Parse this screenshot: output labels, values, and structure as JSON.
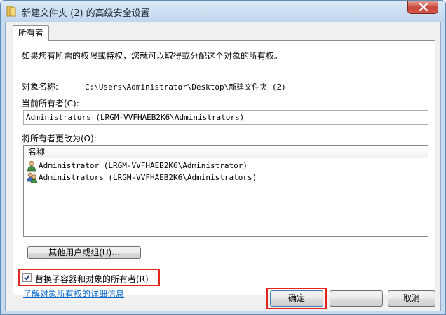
{
  "window": {
    "title": "新建文件夹 (2) 的高级安全设置",
    "close_label": "×"
  },
  "tab": {
    "label": "所有者"
  },
  "intro_text": "如果您有所需的权限或特权，您就可以取得或分配这个对象的所有权。",
  "object_name": {
    "label": "对象名称:",
    "value": "C:\\Users\\Administrator\\Desktop\\新建文件夹 (2)"
  },
  "current_owner": {
    "label": "当前所有者(C):",
    "value": "Administrators (LRGM-VVFHAEB2K6\\Administrators)"
  },
  "change_owner": {
    "label": "将所有者更改为(O):",
    "column_header": "名称",
    "items": [
      {
        "icon": "user-icon",
        "label": "Administrator (LRGM-VVFHAEB2K6\\Administrator)"
      },
      {
        "icon": "group-icon",
        "label": "Administrators (LRGM-VVFHAEB2K6\\Administrators)"
      }
    ]
  },
  "other_users_button": "其他用户或组(U)...",
  "replace_owner_checkbox": {
    "label": "替换子容器和对象的所有者(R)",
    "checked": true
  },
  "learn_more_link": "了解对象所有权的详细信息",
  "buttons": {
    "ok": "确定",
    "cancel": "取消"
  },
  "colors": {
    "highlight_frame": "#e2261c",
    "link": "#0066cc",
    "title_bar": "#c1d7ee"
  }
}
